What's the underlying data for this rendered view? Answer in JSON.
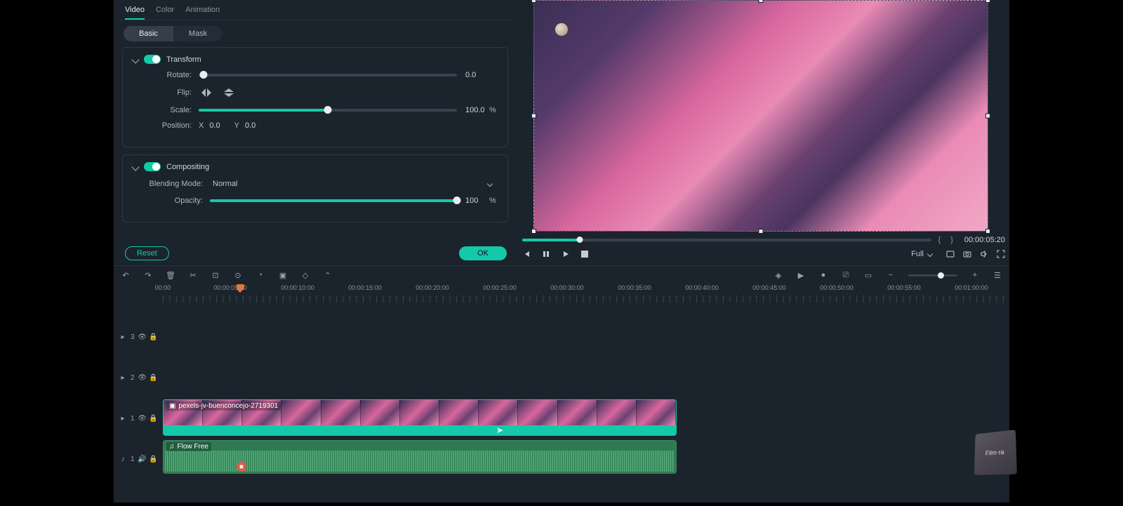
{
  "tabs": {
    "video": "Video",
    "color": "Color",
    "animation": "Animation"
  },
  "subtabs": {
    "basic": "Basic",
    "mask": "Mask"
  },
  "transform": {
    "title": "Transform",
    "rotate_label": "Rotate:",
    "rotate_value": "0.0",
    "flip_label": "Flip:",
    "scale_label": "Scale:",
    "scale_value": "100.0",
    "scale_unit": "%",
    "position_label": "Position:",
    "x_label": "X",
    "x_value": "0.0",
    "y_label": "Y",
    "y_value": "0.0"
  },
  "compositing": {
    "title": "Compositing",
    "blending_label": "Blending Mode:",
    "blending_value": "Normal",
    "opacity_label": "Opacity:",
    "opacity_value": "100",
    "opacity_unit": "%"
  },
  "buttons": {
    "reset": "Reset",
    "ok": "OK"
  },
  "preview": {
    "timecode": "00:00:05:20",
    "size_label": "Full"
  },
  "ruler": [
    "00:00",
    "00:00:05:00",
    "00:00:10:00",
    "00:00:15:00",
    "00:00:20:00",
    "00:00:25:00",
    "00:00:30:00",
    "00:00:35:00",
    "00:00:40:00",
    "00:00:45:00",
    "00:00:50:00",
    "00:00:55:00",
    "00:01:00:00"
  ],
  "tracks": {
    "v3": "3",
    "v2": "2",
    "v1": "1",
    "a1": "1"
  },
  "clips": {
    "video_name": "pexels-jv-buenconcejo-2719301",
    "audio_name": "Flow Free"
  },
  "watermark": "Film·ra"
}
